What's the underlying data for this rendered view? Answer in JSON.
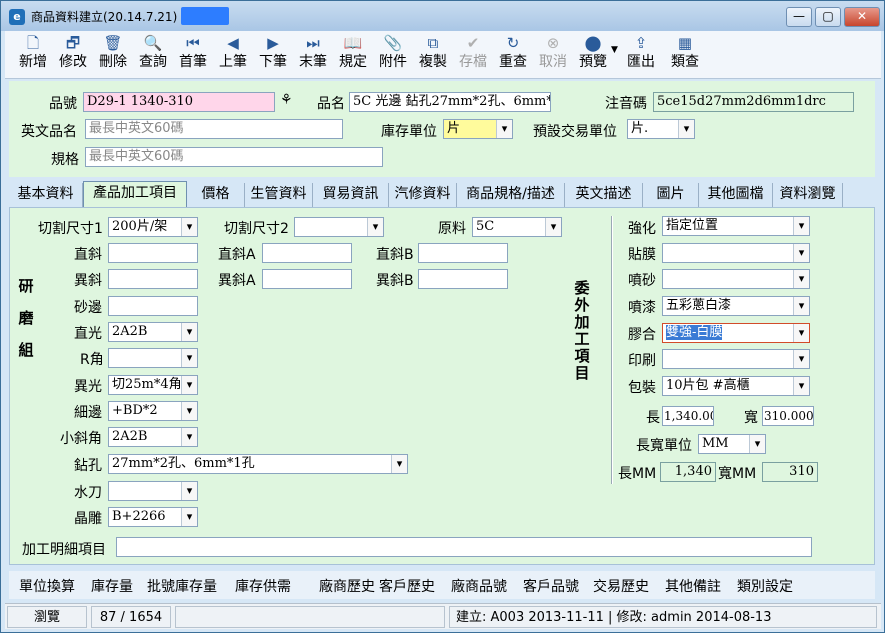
{
  "window": {
    "title": "商品資料建立(20.14.7.21) -",
    "minimize": "—",
    "maximize": "▢",
    "close": "✕"
  },
  "toolbar": [
    {
      "label": "新增",
      "icon": "new-doc-icon",
      "glyph": "🗋",
      "disabled": false
    },
    {
      "label": "修改",
      "icon": "edit-icon",
      "glyph": "🗗",
      "disabled": false
    },
    {
      "label": "刪除",
      "icon": "trash-icon",
      "glyph": "🗑",
      "disabled": false
    },
    {
      "label": "查詢",
      "icon": "search-icon",
      "glyph": "🔍",
      "disabled": false
    },
    {
      "label": "首筆",
      "icon": "first-record-icon",
      "glyph": "⏮",
      "disabled": false
    },
    {
      "label": "上筆",
      "icon": "prev-record-icon",
      "glyph": "◀",
      "disabled": false
    },
    {
      "label": "下筆",
      "icon": "next-record-icon",
      "glyph": "▶",
      "disabled": false
    },
    {
      "label": "末筆",
      "icon": "last-record-icon",
      "glyph": "⏭",
      "disabled": false
    },
    {
      "label": "規定",
      "icon": "book-icon",
      "glyph": "📖",
      "disabled": false
    },
    {
      "label": "附件",
      "icon": "attachment-icon",
      "glyph": "📎",
      "disabled": false
    },
    {
      "label": "複製",
      "icon": "copy-icon",
      "glyph": "⧉",
      "disabled": false
    },
    {
      "label": "存檔",
      "icon": "save-icon",
      "glyph": "✔",
      "disabled": true
    },
    {
      "label": "重查",
      "icon": "refresh-icon",
      "glyph": "↻",
      "disabled": false
    },
    {
      "label": "取消",
      "icon": "cancel-icon",
      "glyph": "⊗",
      "disabled": true
    },
    {
      "label": "預覽",
      "icon": "preview-icon",
      "glyph": "⬤",
      "disabled": false
    },
    {
      "label": "匯出",
      "icon": "export-icon",
      "glyph": "⇪",
      "disabled": false
    },
    {
      "label": "類查",
      "icon": "grid-icon",
      "glyph": "▦",
      "disabled": false
    }
  ],
  "header": {
    "product_no_label": "品號",
    "product_no": "D29-1 1340-310",
    "product_name_label": "品名",
    "product_name": "5C 光邊 鉆孔27mm*2孔、6mm*",
    "phonetic_label": "注音碼",
    "phonetic": "5ce15d27mm2d6mm1drc",
    "en_name_label": "英文品名",
    "en_name_placeholder": "最長中英文60碼",
    "stock_unit_label": "庫存單位",
    "stock_unit": "片",
    "trade_unit_label": "預設交易單位",
    "trade_unit": "片.",
    "spec_label": "規格",
    "spec_placeholder": "最長中英文60碼"
  },
  "tabs": [
    "基本資料",
    "產品加工項目",
    "價格",
    "生管資料",
    "貿易資訊",
    "汽修資料",
    "商品規格/描述",
    "英文描述",
    "圖片",
    "其他圖檔",
    "資料瀏覽"
  ],
  "active_tab": 1,
  "processing": {
    "cut1_label": "切割尺寸1",
    "cut1": "200片/架",
    "cut2_label": "切割尺寸2",
    "cut2": "",
    "material_label": "原料",
    "material": "5C",
    "straight_bevel_label": "直斜",
    "straight_bevel": "",
    "straight_bevel_a_label": "直斜A",
    "straight_bevel_a": "",
    "straight_bevel_b_label": "直斜B",
    "straight_bevel_b": "",
    "odd_bevel_label": "異斜",
    "odd_bevel": "",
    "odd_bevel_a_label": "異斜A",
    "odd_bevel_a": "",
    "odd_bevel_b_label": "異斜B",
    "odd_bevel_b": "",
    "sand_edge_label": "砂邊",
    "sand_edge": "",
    "straight_polish_label": "直光",
    "straight_polish": "2A2B",
    "r_corner_label": "R角",
    "r_corner": "",
    "odd_polish_label": "異光",
    "odd_polish": "切25m*4角",
    "fine_edge_label": "細邊",
    "fine_edge": "+BD*2",
    "small_bevel_label": "小斜角",
    "small_bevel": "2A2B",
    "drill_label": "鉆孔",
    "drill": "27mm*2孔、6mm*1孔",
    "water_knife_label": "水刀",
    "water_knife": "",
    "carving_label": "晶雕",
    "carving": "B+2266",
    "detail_label": "加工明細項目",
    "detail": "",
    "grinding_group": "研磨組",
    "outsource_label": "委外加工項目"
  },
  "outsource": {
    "tempering_label": "強化",
    "tempering": "指定位置",
    "lamination_label": "貼膜",
    "lamination": "",
    "sandblast_label": "噴砂",
    "sandblast": "",
    "paint_label": "噴漆",
    "paint": "五彩蔥白漆",
    "laminated_label": "膠合",
    "laminated": "雙強-白膜",
    "print_label": "印刷",
    "print": "",
    "packing_label": "包裝",
    "packing": "10片包 #高櫃",
    "length_label": "長",
    "length": "1,340.000",
    "width_label": "寬",
    "width": "310.000",
    "size_unit_label": "長寬單位",
    "size_unit": "MM",
    "length_mm_label": "長MM",
    "length_mm": "1,340",
    "width_mm_label": "寬MM",
    "width_mm": "310"
  },
  "links": [
    "單位換算",
    "庫存量",
    "批號庫存量",
    "庫存供需",
    "廠商歷史",
    "客戶歷史",
    "廠商品號",
    "客戶品號",
    "交易歷史",
    "其他備註",
    "類別設定"
  ],
  "status": {
    "mode": "瀏覽",
    "record": "87 / 1654",
    "info": "建立: A003 2013-11-11 | 修改: admin 2014-08-13"
  },
  "colors": {
    "form_bg": "#dff6df",
    "pink_field": "#ffd6ea",
    "yellow_field": "#fffb9c",
    "selected_text": "#3a7bd5"
  }
}
